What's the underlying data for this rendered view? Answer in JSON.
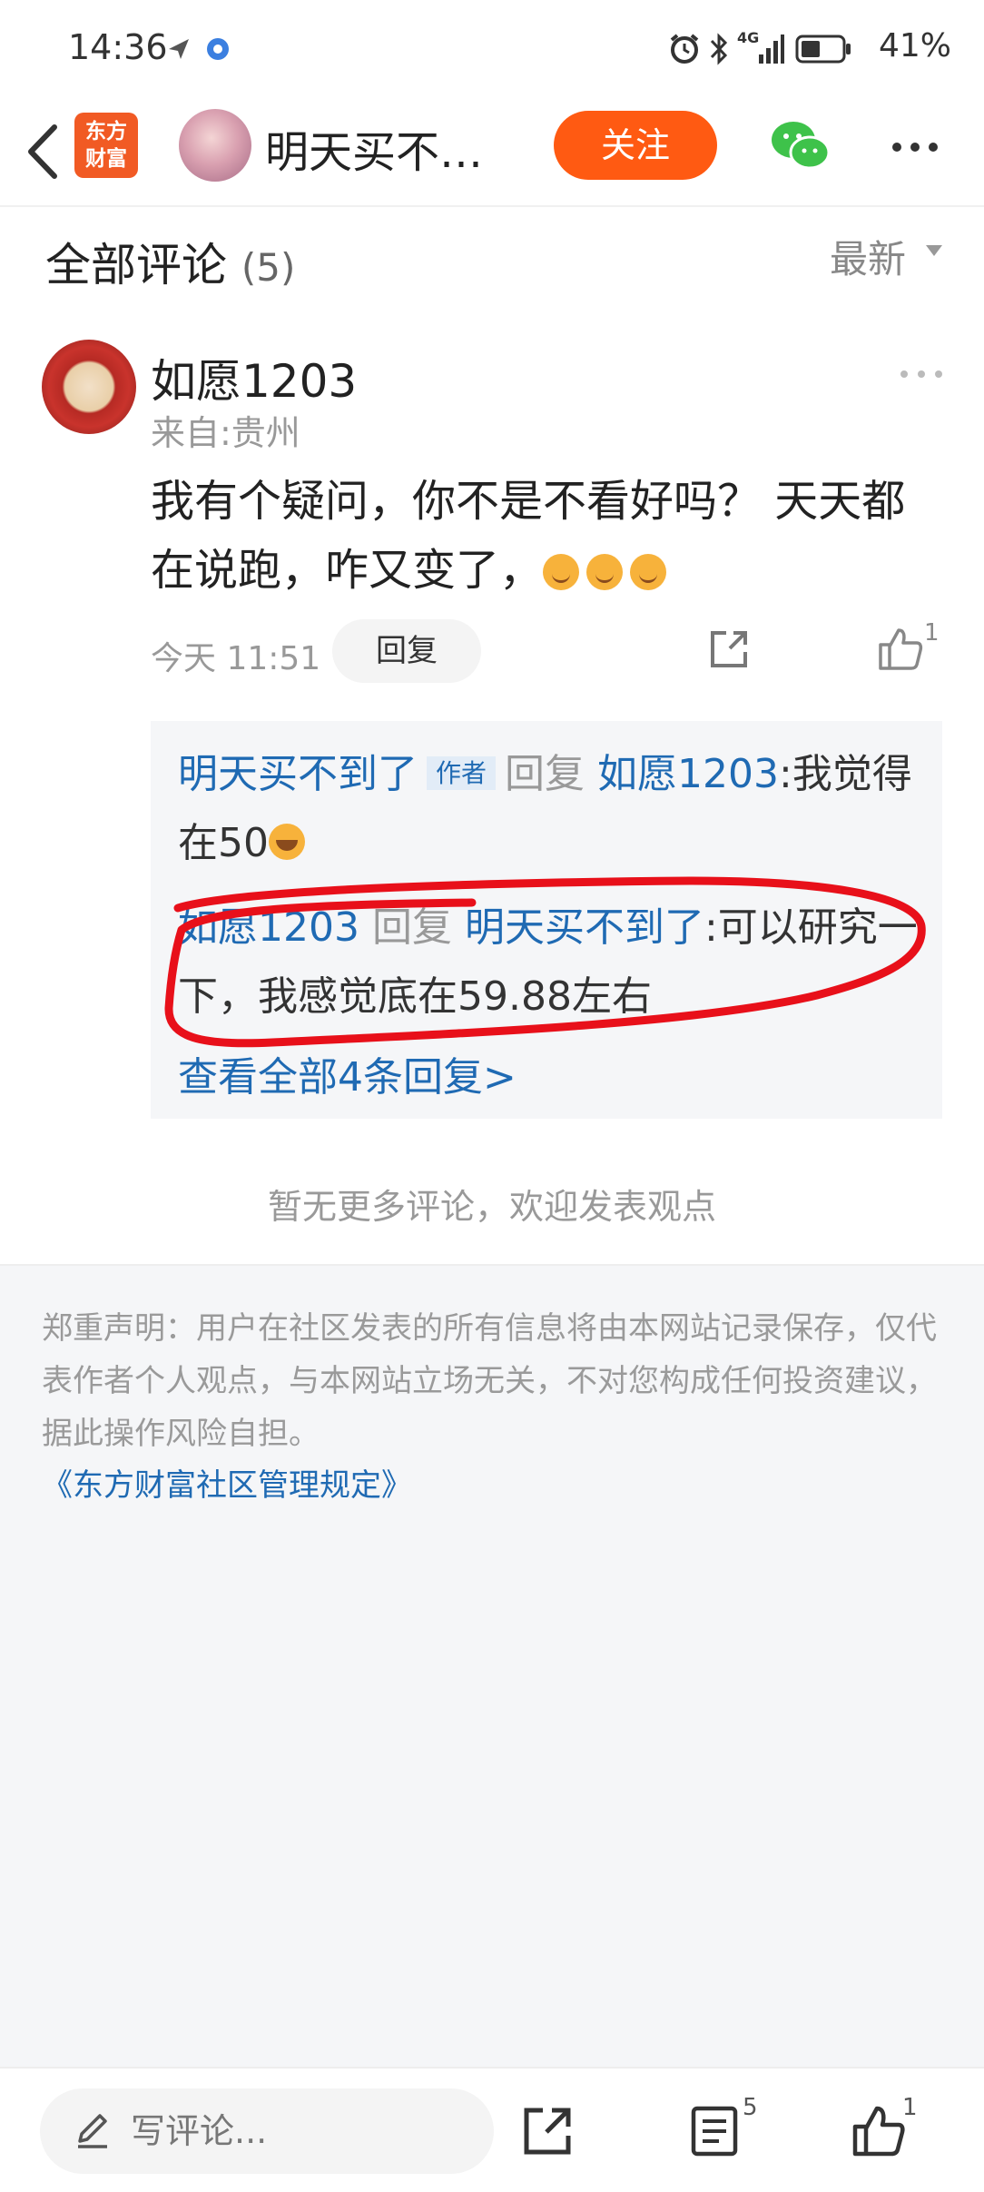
{
  "status_bar": {
    "time": "14:36",
    "battery_percent": "41%",
    "network_label": "4G",
    "icons": [
      "location-icon",
      "app-notification-icon",
      "alarm-icon",
      "bluetooth-icon",
      "signal-icon",
      "battery-icon"
    ]
  },
  "header": {
    "logo_text_line1": "东方",
    "logo_text_line2": "财富",
    "title": "明天买不…",
    "follow_label": "关注"
  },
  "comments_header": {
    "title": "全部评论",
    "count": "(5)",
    "sort_label": "最新"
  },
  "comment": {
    "username": "如愿1203",
    "location": "来自:贵州",
    "text": "我有个疑问，你不是不看好吗？ 天天都在说跑，咋又变了，",
    "time": "今天 11:51",
    "reply_label": "回复",
    "like_count": "1"
  },
  "replies": [
    {
      "from": "明天买不到了",
      "author_tag": "作者",
      "verb": "回复",
      "to": "如愿1203",
      "text": ":我觉得在50"
    },
    {
      "from": "如愿1203",
      "verb": "回复",
      "to": "明天买不到了",
      "text": ":可以研究一下，我感觉底在59.88左右"
    }
  ],
  "view_all_label": "查看全部4条回复>",
  "no_more_text": "暂无更多评论，欢迎发表观点",
  "disclaimer": {
    "text": "郑重声明：用户在社区发表的所有信息将由本网站记录保存，仅代表作者个人观点，与本网站立场无关，不对您构成任何投资建议，据此操作风险自担。",
    "link": "《东方财富社区管理规定》"
  },
  "bottom_bar": {
    "input_placeholder": "写评论...",
    "list_count": "5",
    "like_count": "1"
  },
  "colors": {
    "accent": "#ff5a12",
    "link_blue": "#1f6ab3",
    "annotation_red": "#e8101a"
  }
}
